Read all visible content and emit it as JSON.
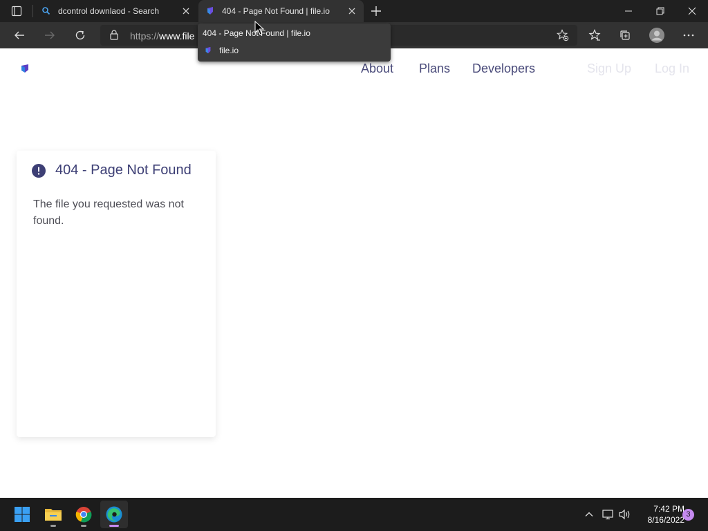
{
  "browser": {
    "tabs": [
      {
        "title": "dcontrol downlaod - Search",
        "icon": "search-icon",
        "active": false
      },
      {
        "title": "404 - Page Not Found | file.io",
        "icon": "fileio-favicon",
        "active": true
      }
    ],
    "address": {
      "url_prefix": "https://",
      "url_host": "www.file"
    },
    "tooltip": {
      "title": "404 - Page Not Found | file.io",
      "site": "file.io"
    }
  },
  "page": {
    "nav": {
      "about": "About",
      "plans": "Plans",
      "developers": "Developers",
      "signup": "Sign Up",
      "login": "Log In"
    },
    "error": {
      "title": "404 - Page Not Found",
      "message": "The file you requested was not found."
    }
  },
  "taskbar": {
    "clock": {
      "time": "7:42 PM",
      "date": "8/16/2022"
    },
    "notifications": "3"
  },
  "colors": {
    "accent": "#3d3f75",
    "brand_purple": "#5b3fc4",
    "edge_accent": "#c58af0"
  }
}
